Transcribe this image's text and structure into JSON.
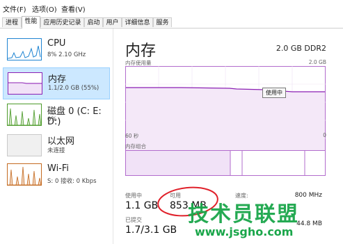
{
  "menu": {
    "file": "文件(F)",
    "options": "选项(O)",
    "view": "查看(V)"
  },
  "tabs": [
    "进程",
    "性能",
    "应用历史记录",
    "启动",
    "用户",
    "详细信息",
    "服务"
  ],
  "sidebar": {
    "items": [
      {
        "title": "CPU",
        "sub": "8% 2.10 GHz"
      },
      {
        "title": "内存",
        "sub": "1.1/2.0 GB (55%)"
      },
      {
        "title": "磁盘 0 (C: E: D:)",
        "sub": "0%"
      },
      {
        "title": "以太网",
        "sub": "未连接"
      },
      {
        "title": "Wi-Fi",
        "sub": "S: 0 接收: 0 Kbps"
      }
    ]
  },
  "memory": {
    "title": "内存",
    "spec": "2.0 GB DDR2",
    "usage_label": "内存使用量",
    "usage_max": "2.0 GB",
    "time_left": "60 秒",
    "time_right": "0",
    "composition_label": "内存组合",
    "tooltip": "使用中",
    "in_use_label": "使用中",
    "in_use_value": "1.1 GB",
    "available_label": "可用",
    "available_value": "853 MB",
    "committed_label": "已提交",
    "committed_value": "1.7/3.1 GB",
    "speed_label": "速度:",
    "speed_value": "800 MHz",
    "form_value": "44.8 MB"
  },
  "watermark": {
    "brand": "技术员联盟",
    "url": "www.jsgho.com"
  },
  "colors": {
    "memory": "#8b1fb3",
    "cpu": "#1e84d2",
    "disk": "#4c9a2a",
    "wifi": "#c46a20",
    "annotation": "#e0202a",
    "watermark": "#1aa64a"
  }
}
